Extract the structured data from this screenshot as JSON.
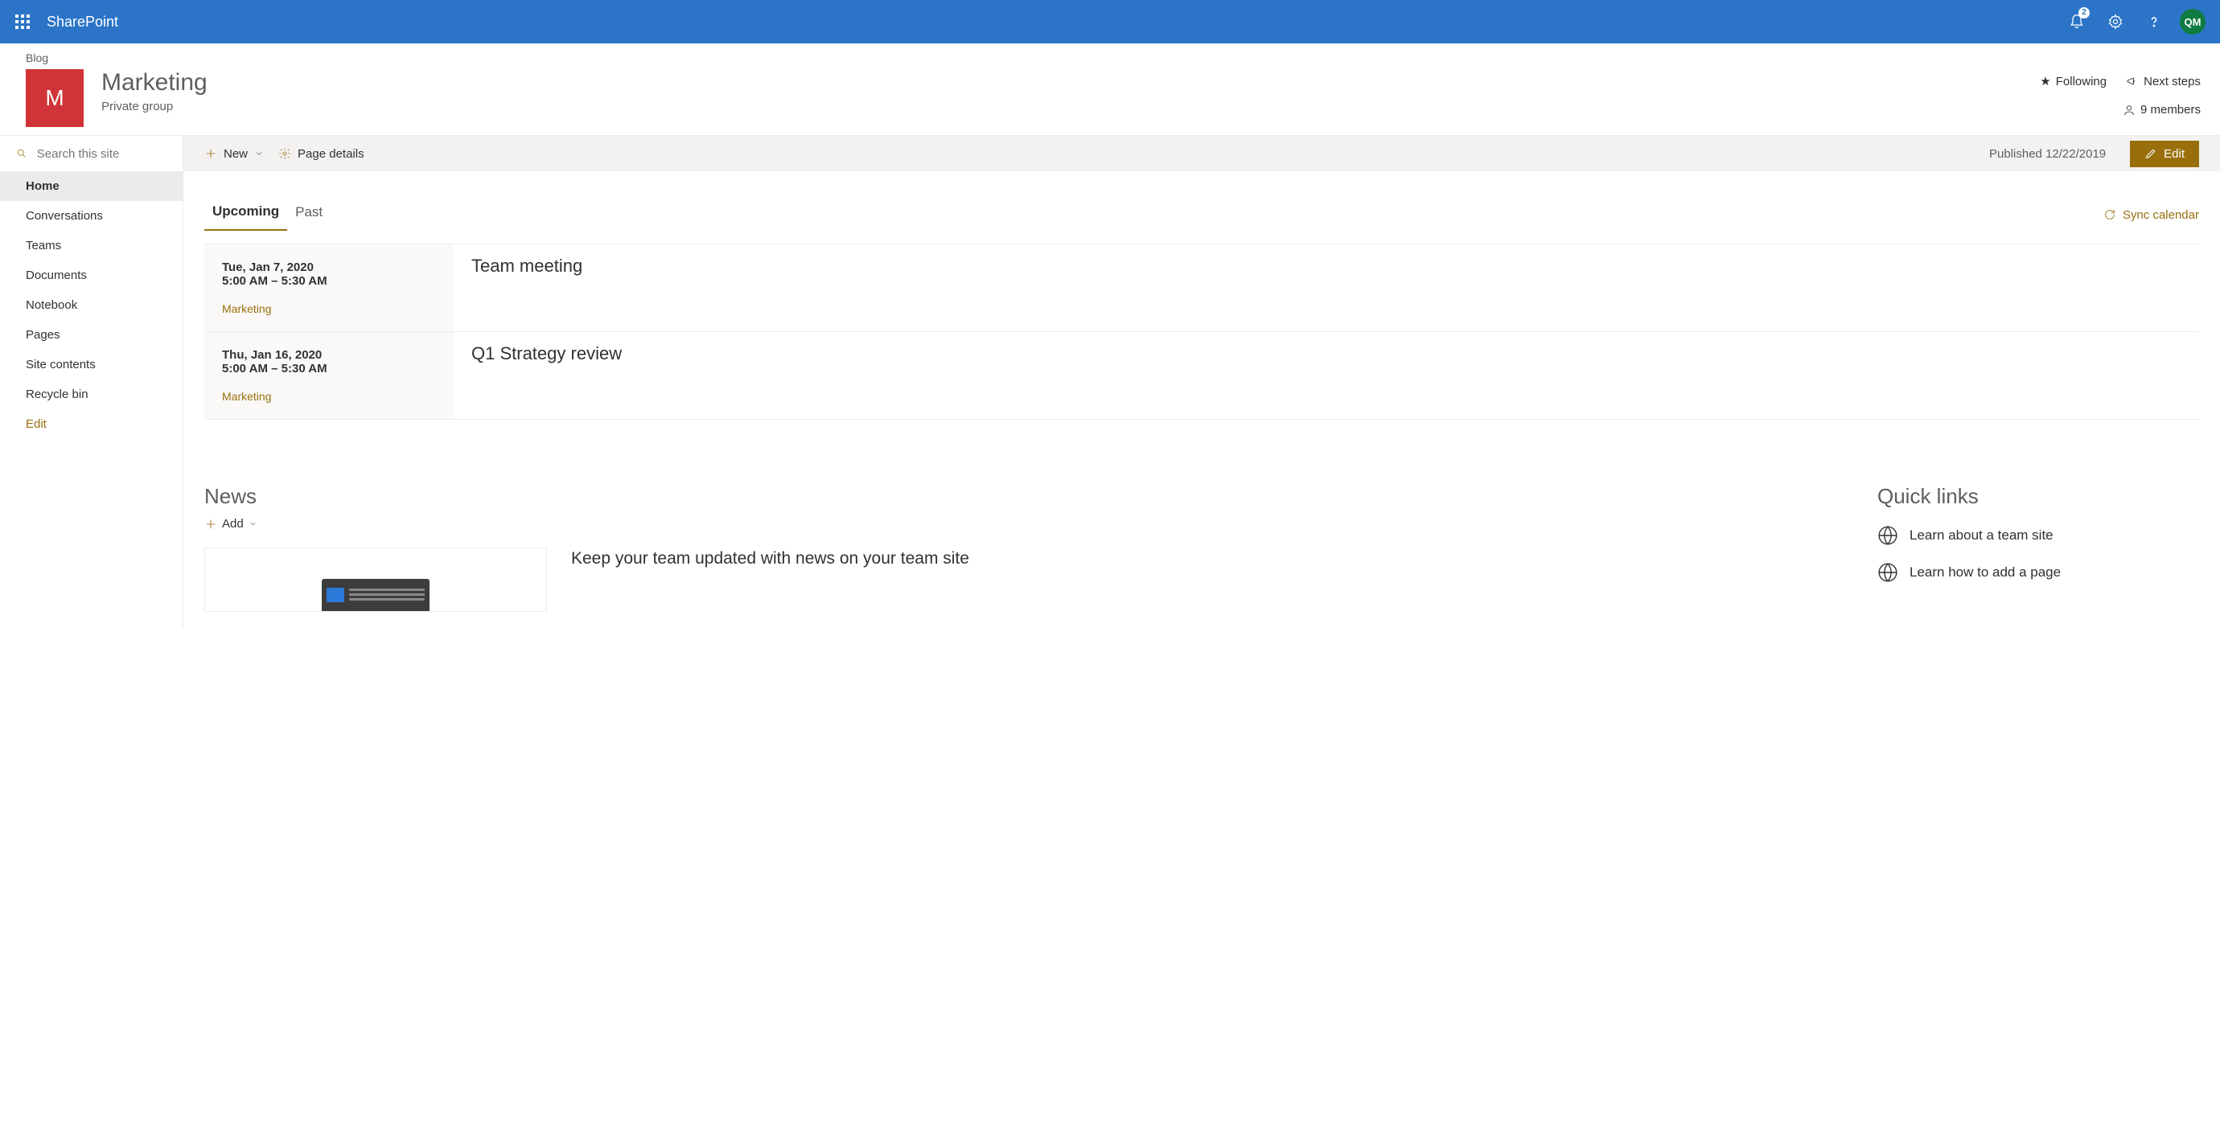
{
  "app": {
    "name": "SharePoint",
    "notification_count": "2",
    "avatar_initials": "QM"
  },
  "site": {
    "blog_label": "Blog",
    "logo_letter": "M",
    "title": "Marketing",
    "privacy": "Private group",
    "following": "Following",
    "next_steps": "Next steps",
    "members": "9 members"
  },
  "search": {
    "placeholder": "Search this site"
  },
  "nav": {
    "items": [
      {
        "label": "Home"
      },
      {
        "label": "Conversations"
      },
      {
        "label": "Teams"
      },
      {
        "label": "Documents"
      },
      {
        "label": "Notebook"
      },
      {
        "label": "Pages"
      },
      {
        "label": "Site contents"
      },
      {
        "label": "Recycle bin"
      }
    ],
    "edit": "Edit"
  },
  "toolbar": {
    "new": "New",
    "page_details": "Page details",
    "published": "Published 12/22/2019",
    "edit": "Edit"
  },
  "events": {
    "tabs": {
      "upcoming": "Upcoming",
      "past": "Past"
    },
    "sync": "Sync calendar",
    "list": [
      {
        "date": "Tue, Jan 7, 2020",
        "time": "5:00 AM – 5:30 AM",
        "category": "Marketing",
        "title": "Team meeting"
      },
      {
        "date": "Thu, Jan 16, 2020",
        "time": "5:00 AM – 5:30 AM",
        "category": "Marketing",
        "title": "Q1 Strategy review"
      }
    ]
  },
  "news": {
    "title": "News",
    "add": "Add",
    "blurb": "Keep your team updated with news on your team site"
  },
  "quick": {
    "title": "Quick links",
    "items": [
      {
        "label": "Learn about a team site"
      },
      {
        "label": "Learn how to add a page"
      }
    ]
  }
}
